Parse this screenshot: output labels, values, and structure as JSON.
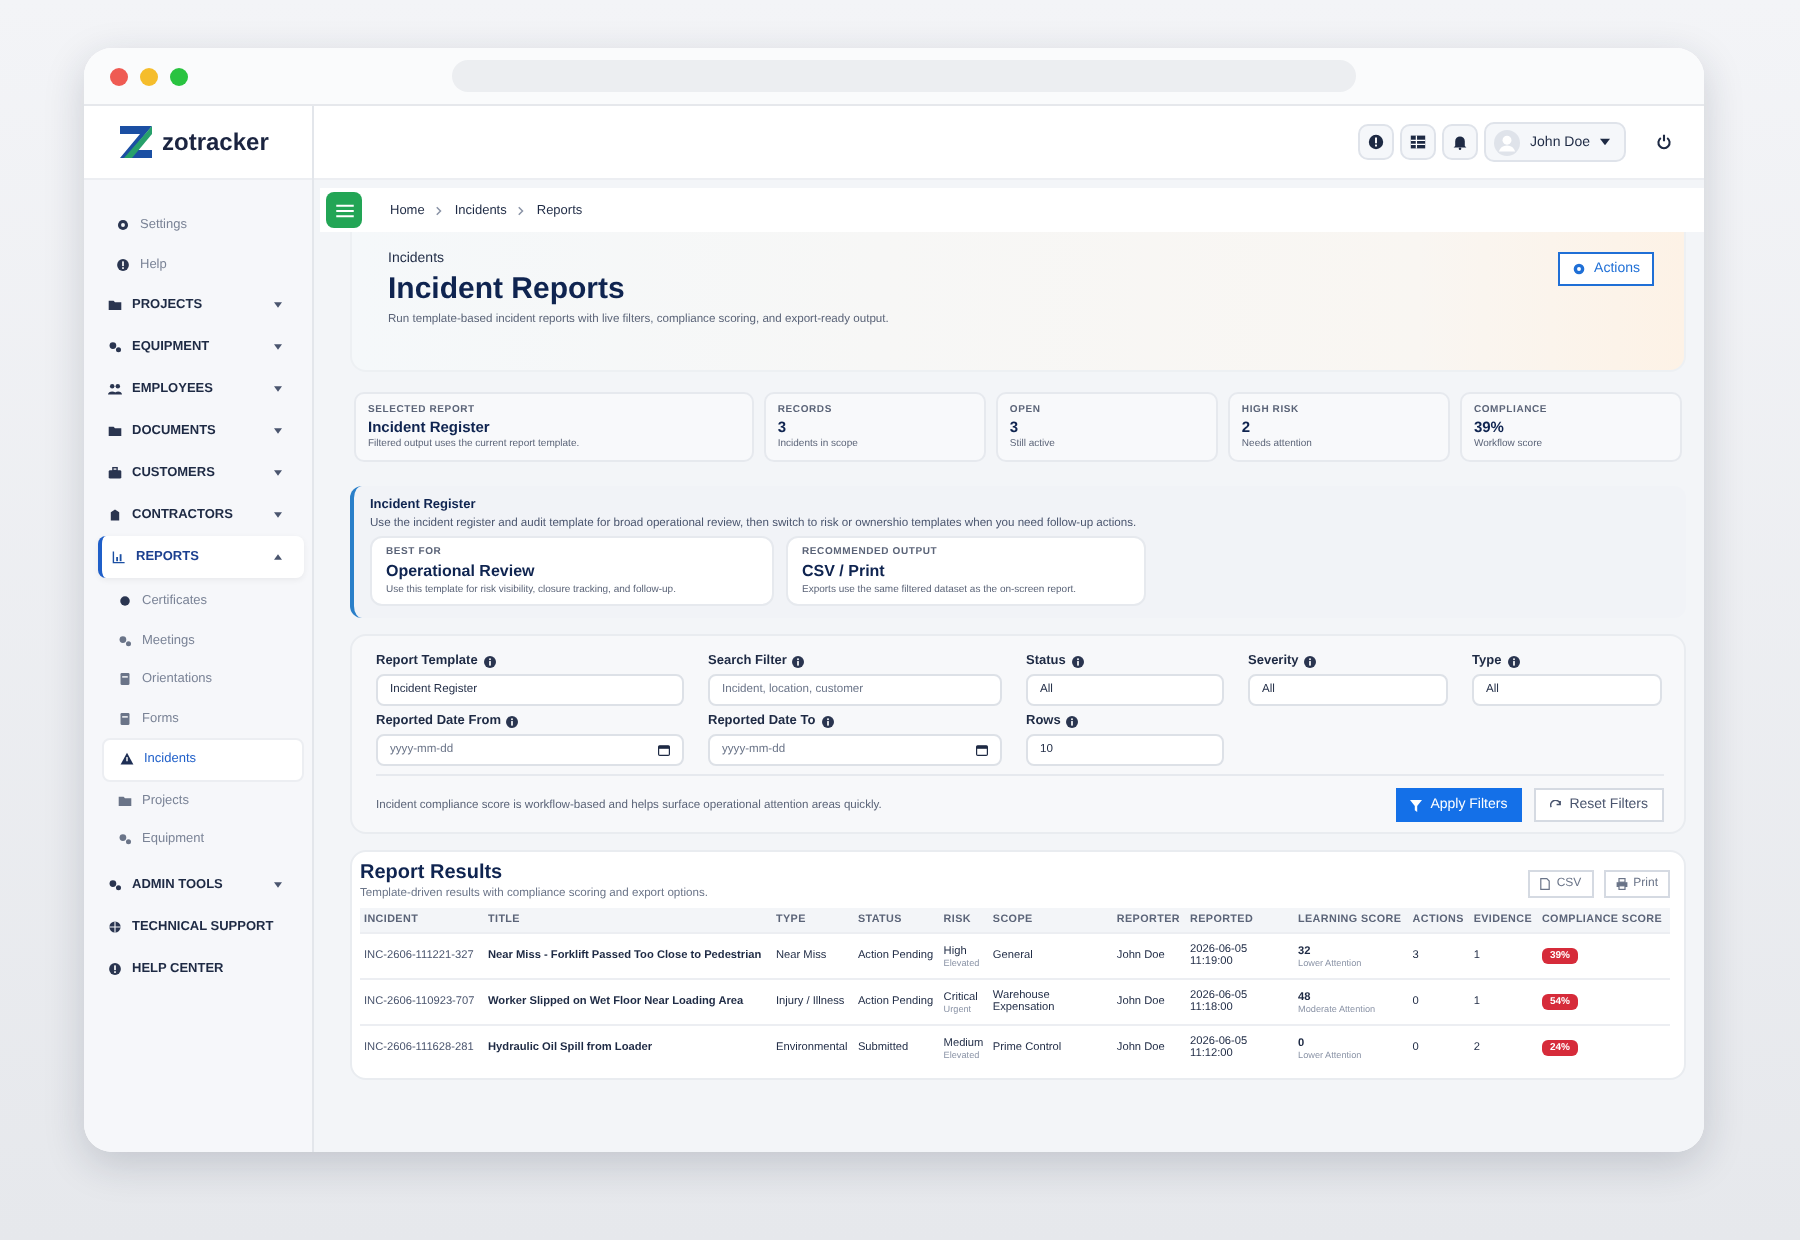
{
  "brand": {
    "name": "zotracker"
  },
  "topbar": {
    "user": "John Doe"
  },
  "sidebar": {
    "items": [
      {
        "kind": "minor",
        "label": "Settings",
        "selected": false
      },
      {
        "kind": "minor",
        "label": "Help",
        "selected": false
      },
      {
        "kind": "group",
        "label": "PROJECTS",
        "expanded": false,
        "selected": false
      },
      {
        "kind": "group",
        "label": "EQUIPMENT",
        "expanded": false,
        "selected": false
      },
      {
        "kind": "group",
        "label": "EMPLOYEES",
        "expanded": false,
        "selected": false
      },
      {
        "kind": "group",
        "label": "DOCUMENTS",
        "expanded": false,
        "selected": false
      },
      {
        "kind": "group",
        "label": "CUSTOMERS",
        "expanded": false,
        "selected": false
      },
      {
        "kind": "group",
        "label": "CONTRACTORS",
        "expanded": false,
        "selected": false
      },
      {
        "kind": "group",
        "label": "REPORTS",
        "expanded": true,
        "selected": true,
        "children": [
          {
            "label": "Certificates",
            "selected": false
          },
          {
            "label": "Meetings",
            "selected": false
          },
          {
            "label": "Orientations",
            "selected": false
          },
          {
            "label": "Forms",
            "selected": false
          },
          {
            "label": "Incidents",
            "selected": true
          },
          {
            "label": "Projects",
            "selected": false
          },
          {
            "label": "Equipment",
            "selected": false
          }
        ]
      },
      {
        "kind": "group",
        "label": "ADMIN TOOLS",
        "expanded": false,
        "selected": false
      },
      {
        "kind": "link",
        "label": "TECHNICAL SUPPORT",
        "selected": false
      },
      {
        "kind": "link",
        "label": "HELP CENTER",
        "selected": false
      }
    ]
  },
  "breadcrumb": [
    "Home",
    "Incidents",
    "Reports"
  ],
  "hero": {
    "eyebrow": "Incidents",
    "title": "Incident Reports",
    "subtitle": "Run template-based incident reports with live filters, compliance scoring, and export-ready output.",
    "action": "Actions"
  },
  "stats": [
    {
      "label": "SELECTED REPORT",
      "value": "Incident Register",
      "note": "Filtered output uses the current report template."
    },
    {
      "label": "RECORDS",
      "value": "3",
      "note": "Incidents in scope"
    },
    {
      "label": "OPEN",
      "value": "3",
      "note": "Still active"
    },
    {
      "label": "HIGH RISK",
      "value": "2",
      "note": "Needs attention"
    },
    {
      "label": "COMPLIANCE",
      "value": "39%",
      "note": "Workflow score"
    }
  ],
  "template_info": {
    "title": "Incident Register",
    "description": "Use the incident register and audit template for broad operational review, then switch to risk or ownershio templates when you need follow-up actions.",
    "cards": [
      {
        "label": "BEST FOR",
        "value": "Operational Review",
        "note": "Use this template for risk visibility, closure tracking, and follow-up."
      },
      {
        "label": "RECOMMENDED OUTPUT",
        "value": "CSV / Print",
        "note": "Exports use the same filtered dataset as the on-screen report."
      }
    ]
  },
  "filters": {
    "fields": [
      {
        "kind": "text",
        "label": "Report Template",
        "value": "Incident Register"
      },
      {
        "kind": "text",
        "label": "Search Filter",
        "placeholder": "Incident, location, customer"
      },
      {
        "kind": "text",
        "label": "Status",
        "value": "All"
      },
      {
        "kind": "text",
        "label": "Severity",
        "value": "All"
      },
      {
        "kind": "text",
        "label": "Type",
        "value": "All"
      },
      {
        "kind": "date",
        "label": "Reported Date From",
        "placeholder": "yyyy-mm-dd"
      },
      {
        "kind": "date",
        "label": "Reported Date To",
        "placeholder": "yyyy-mm-dd"
      },
      {
        "kind": "text",
        "label": "Rows",
        "value": "10"
      }
    ],
    "note": "Incident compliance score is workflow-based and helps surface operational attention areas quickly.",
    "apply": "Apply Filters",
    "reset": "Reset Filters"
  },
  "results": {
    "title": "Report Results",
    "subtitle": "Template-driven results with compliance scoring and export options.",
    "export_buttons": [
      "CSV",
      "Print"
    ],
    "columns": [
      "INCIDENT",
      "TITLE",
      "TYPE",
      "STATUS",
      "RISK",
      "SCOPE",
      "REPORTER",
      "REPORTED",
      "LEARNING SCORE",
      "ACTIONS",
      "EVIDENCE",
      "COMPLIANCE SCORE"
    ],
    "rows": [
      {
        "incident": "INC-2606-111221-327",
        "title": "Near Miss - Forklift Passed Too Close to Pedestrian",
        "type": "Near Miss",
        "status": "Action Pending",
        "risk": "High",
        "risk_note": "Elevated",
        "scope": "General",
        "reporter": "John Doe",
        "reported": "2026-06-05 11:19:00",
        "learning": "32",
        "learning_note": "Lower Attention",
        "actions": "3",
        "evidence": "1",
        "compliance": "39%"
      },
      {
        "incident": "INC-2606-110923-707",
        "title": "Worker Slipped on Wet Floor Near Loading Area",
        "type": "Injury / Illness",
        "status": "Action Pending",
        "risk": "Critical",
        "risk_note": "Urgent",
        "scope": "Warehouse Expensation",
        "reporter": "John Doe",
        "reported": "2026-06-05 11:18:00",
        "learning": "48",
        "learning_note": "Moderate Attention",
        "actions": "0",
        "evidence": "1",
        "compliance": "54%"
      },
      {
        "incident": "INC-2606-111628-281",
        "title": "Hydraulic Oil Spill from Loader",
        "type": "Environmental",
        "status": "Submitted",
        "risk": "Medium",
        "risk_note": "Elevated",
        "scope": "Prime Control",
        "reporter": "John Doe",
        "reported": "2026-06-05 11:12:00",
        "learning": "0",
        "learning_note": "Lower Attention",
        "actions": "0",
        "evidence": "2",
        "compliance": "24%"
      }
    ]
  }
}
